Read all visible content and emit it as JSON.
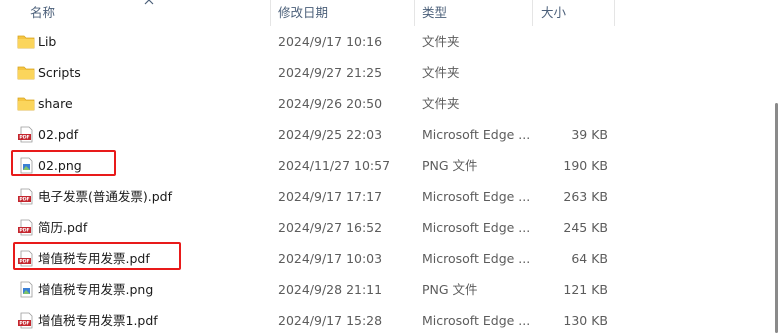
{
  "header": {
    "name": "名称",
    "date": "修改日期",
    "type": "类型",
    "size": "大小"
  },
  "files": [
    {
      "icon": "folder-icon",
      "name": "Lib",
      "date": "2024/9/17 10:16",
      "type": "文件夹",
      "size": "",
      "highlighted": false
    },
    {
      "icon": "folder-icon",
      "name": "Scripts",
      "date": "2024/9/27 21:25",
      "type": "文件夹",
      "size": "",
      "highlighted": false
    },
    {
      "icon": "folder-icon",
      "name": "share",
      "date": "2024/9/26 20:50",
      "type": "文件夹",
      "size": "",
      "highlighted": false
    },
    {
      "icon": "pdf-file-icon",
      "name": "02.pdf",
      "date": "2024/9/25 22:03",
      "type": "Microsoft Edge ...",
      "size": "39 KB",
      "highlighted": false
    },
    {
      "icon": "png-file-icon",
      "name": "02.png",
      "date": "2024/11/27 10:57",
      "type": "PNG 文件",
      "size": "190 KB",
      "highlighted": true
    },
    {
      "icon": "pdf-file-icon",
      "name": "电子发票(普通发票).pdf",
      "date": "2024/9/17 17:17",
      "type": "Microsoft Edge ...",
      "size": "263 KB",
      "highlighted": false
    },
    {
      "icon": "pdf-file-icon",
      "name": "简历.pdf",
      "date": "2024/9/27 16:52",
      "type": "Microsoft Edge ...",
      "size": "245 KB",
      "highlighted": false
    },
    {
      "icon": "pdf-file-icon",
      "name": "增值税专用发票.pdf",
      "date": "2024/9/17 10:03",
      "type": "Microsoft Edge ...",
      "size": "64 KB",
      "highlighted": true
    },
    {
      "icon": "png-file-icon",
      "name": "增值税专用发票.png",
      "date": "2024/9/28 21:11",
      "type": "PNG 文件",
      "size": "121 KB",
      "highlighted": false
    },
    {
      "icon": "pdf-file-icon",
      "name": "增值税专用发票1.pdf",
      "date": "2024/9/17 15:28",
      "type": "Microsoft Edge ...",
      "size": "130 KB",
      "highlighted": false
    }
  ],
  "colors": {
    "header_text": "#4c607a",
    "folder": "#f5c542",
    "pdf_badge": "#c4262e",
    "highlight": "#e81a1a"
  }
}
